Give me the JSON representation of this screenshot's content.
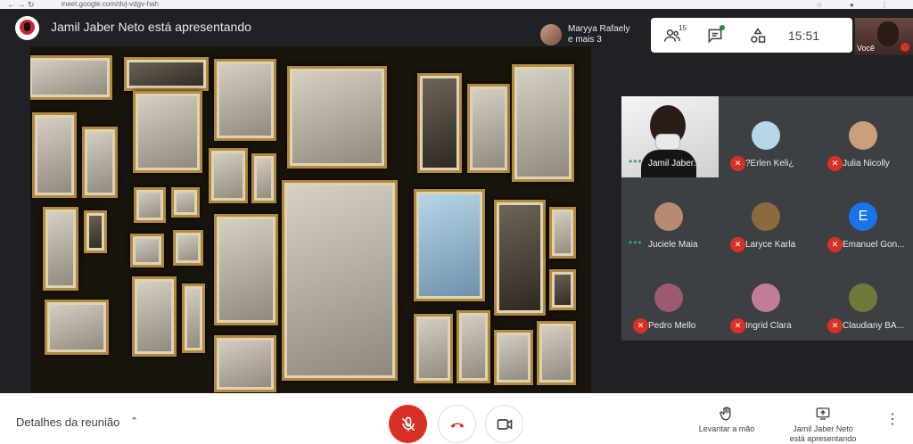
{
  "browser": {
    "nav": "←  →  ↻",
    "url": "meet.google.com/dvj-vdgv-hah",
    "icons": "☆ ● ⋮"
  },
  "header": {
    "presenter_title": "Jamil Jaber Neto está apresentando",
    "viewers_line1": "Maryya Rafaely",
    "viewers_line2": "e mais 3",
    "participants_count": "15",
    "clock": "15:51",
    "self_label": "Você"
  },
  "participants": [
    {
      "name": "Jamil Jaber...",
      "video": true,
      "speaking": true
    },
    {
      "name": "?Erlen Keli¿",
      "muted": true,
      "avatar_color": "#b7d6e8"
    },
    {
      "name": "Julia Nicolly",
      "muted": true,
      "avatar_color": "#c9a07a"
    },
    {
      "name": "Juciele Maia",
      "speaking": true,
      "avatar_color": "#b98a73"
    },
    {
      "name": "Laryce Karla",
      "muted": true,
      "avatar_color": "#8d6a3e"
    },
    {
      "name": "Emanuel Gon...",
      "muted": true,
      "avatar_letter": "E",
      "avatar_color": "#1a73e8"
    },
    {
      "name": "Pedro Mello",
      "muted": true,
      "avatar_color": "#9b5a6e"
    },
    {
      "name": "Ingrid Clara",
      "muted": true,
      "avatar_color": "#c27c9a"
    },
    {
      "name": "Claudiany BA...",
      "muted": true,
      "avatar_color": "#6f7a3a"
    }
  ],
  "bottom": {
    "meeting_details": "Detalhes da reunião",
    "raise_hand": "Levantar a mão",
    "presenting_line1": "Jamil Jaber Neto",
    "presenting_line2": "está apresentando"
  }
}
